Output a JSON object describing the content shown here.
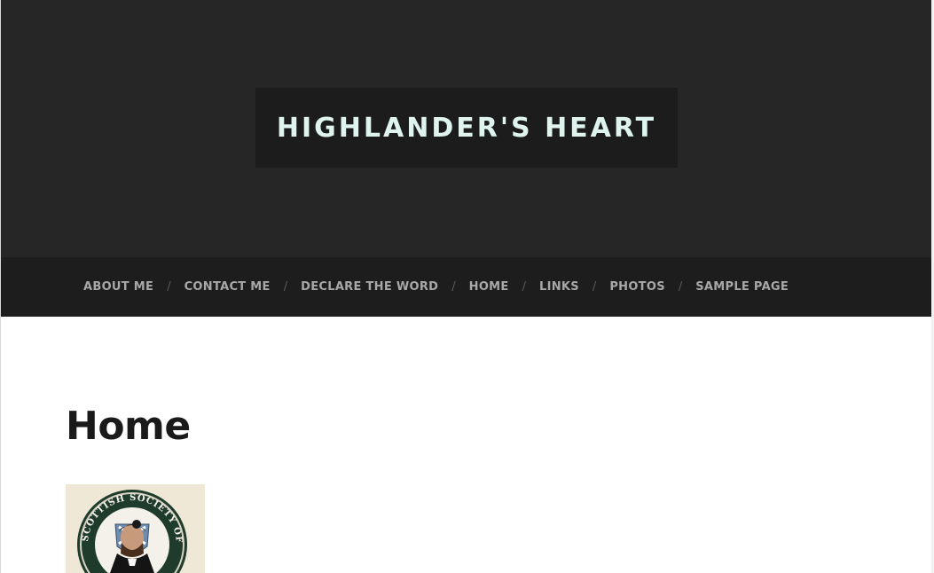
{
  "site": {
    "title": "HIGHLANDER'S HEART"
  },
  "nav": {
    "items": [
      {
        "label": "ABOUT ME"
      },
      {
        "label": "CONTACT ME"
      },
      {
        "label": "DECLARE THE WORD"
      },
      {
        "label": "HOME"
      },
      {
        "label": "LINKS"
      },
      {
        "label": "PHOTOS"
      },
      {
        "label": "SAMPLE PAGE"
      }
    ],
    "separator": "/"
  },
  "main": {
    "page_title": "Home",
    "image": {
      "seal_text": "SCOTTISH SOCIETY OF NEBRASKA"
    }
  },
  "colors": {
    "header_bg": "#262626",
    "title_box_bg": "#1c1c1c",
    "title_text": "#dff4ee",
    "nav_bg": "#1d1d1d",
    "nav_text": "#a8a8a8"
  }
}
